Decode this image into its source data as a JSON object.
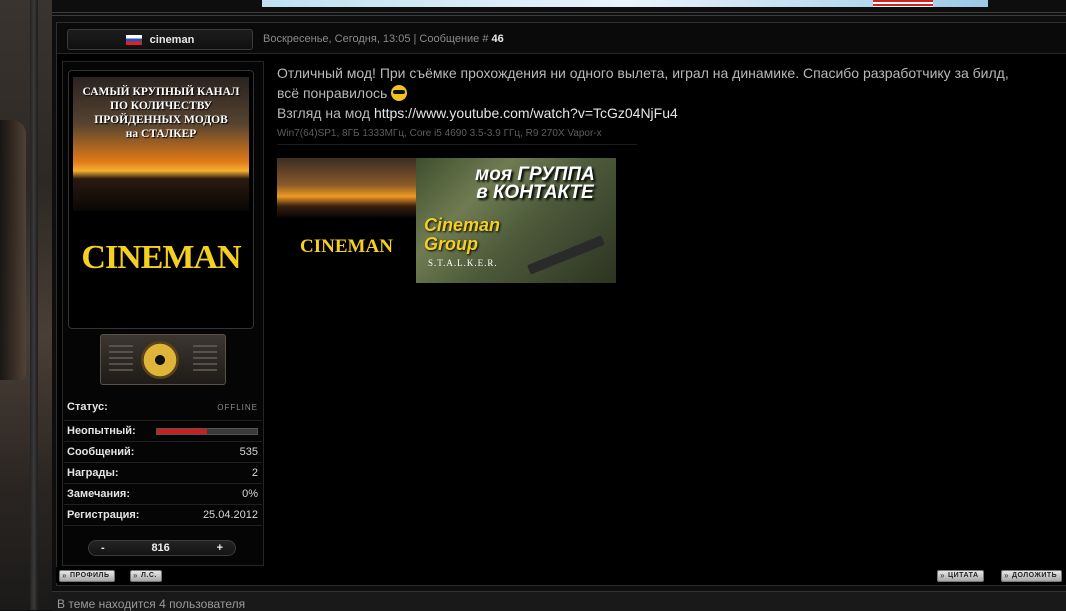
{
  "post": {
    "author": "cineman",
    "date": "Воскресенье, Сегодня, 13:05 | Сообщение #",
    "number": "46",
    "message_line1": "Отличный мод! При съёмке прохождения ни одного вылета, играл на динамике. Спасибо разработчику за билд,",
    "message_line2": "всё понравилось",
    "message_line3_prefix": "Взгляд на мод ",
    "link": "https://www.youtube.com/watch?v=TcGz04NjFu4",
    "signature": "Win7(64)SP1, 8ГБ 1333МГц, Core i5 4690 3.5-3.9 ГГц, R9 270X Vapor-x"
  },
  "avatar": {
    "line1": "САМЫЙ КРУПНЫЙ КАНАЛ",
    "line2": "ПО КОЛИЧЕСТВУ",
    "line3": "ПРОЙДЕННЫХ МОДОВ",
    "line4": "на СТАЛКЕР",
    "name": "CINEMAN"
  },
  "signature_banner": {
    "left_text": "CINEMAN",
    "right_title1": "моя ГРУППА",
    "right_title2": "в КОНТАКТЕ",
    "group1": "Cineman",
    "group2": "Group",
    "game": "S.T.A.L.K.E.R."
  },
  "profile": {
    "status_label": "Статус:",
    "status_value": "OFFLINE",
    "rank_label": "Неопытный:",
    "rank_progress": 0.5,
    "posts_label": "Сообщений:",
    "posts_value": "535",
    "awards_label": "Награды:",
    "awards_value": "2",
    "warnings_label": "Замечания:",
    "warnings_value": "0%",
    "reg_label": "Регистрация:",
    "reg_value": "25.04.2012",
    "rep_minus": "-",
    "rep_value": "816",
    "rep_plus": "+"
  },
  "buttons": {
    "profile": "ПРОФИЛЬ",
    "pm": "Л.С.",
    "quote": "ЦИТАТА",
    "report": "ДОЛОЖИТЬ"
  },
  "footer": {
    "users_text": "В теме находится 4 пользователя"
  }
}
